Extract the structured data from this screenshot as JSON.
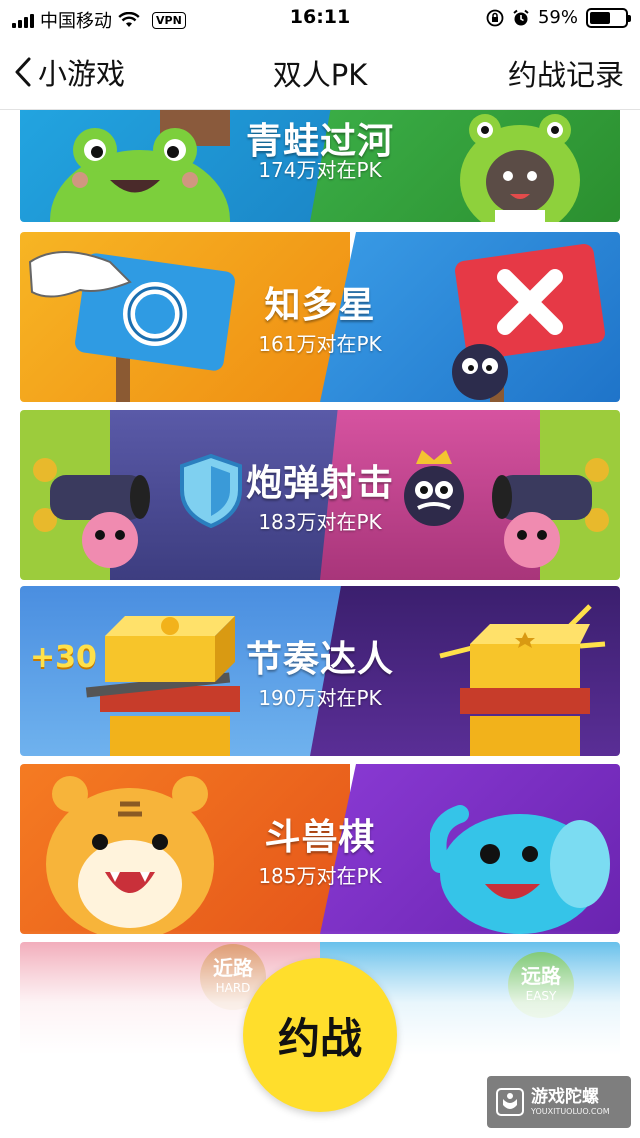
{
  "status_bar": {
    "carrier": "中国移动",
    "vpn": "VPN",
    "time": "16:11",
    "battery": "59%",
    "battery_level": 0.59
  },
  "nav": {
    "back_label": "小游戏",
    "title": "双人PK",
    "action_label": "约战记录"
  },
  "games": [
    {
      "title": "青蛙过河",
      "subtitle": "174万对在PK"
    },
    {
      "title": "知多星",
      "subtitle": "161万对在PK"
    },
    {
      "title": "炮弹射击",
      "subtitle": "183万对在PK"
    },
    {
      "title": "节奏达人",
      "subtitle": "190万对在PK",
      "badge": "+30"
    },
    {
      "title": "斗兽棋",
      "subtitle": "185万对在PK"
    },
    {
      "left_tag": "近路",
      "left_tag_sub": "HARD",
      "right_tag": "远路",
      "right_tag_sub": "EASY"
    }
  ],
  "challenge_button": "约战",
  "watermark": {
    "name": "游戏陀螺",
    "url": "YOUXITUOLUO.COM"
  },
  "colors": {
    "accent_yellow": "#ffde2c",
    "frog_left": "#1f9fd8",
    "frog_right": "#3fae3a",
    "star_left": "#f2a11a",
    "star_right": "#2e8fe0",
    "cannon_left": "#4a4a8e",
    "cannon_right": "#c23f86",
    "rhythm_left": "#3f7fd4",
    "rhythm_right": "#4a2a7e",
    "beast_left": "#ef6a1c",
    "beast_right": "#7b2fc4"
  }
}
